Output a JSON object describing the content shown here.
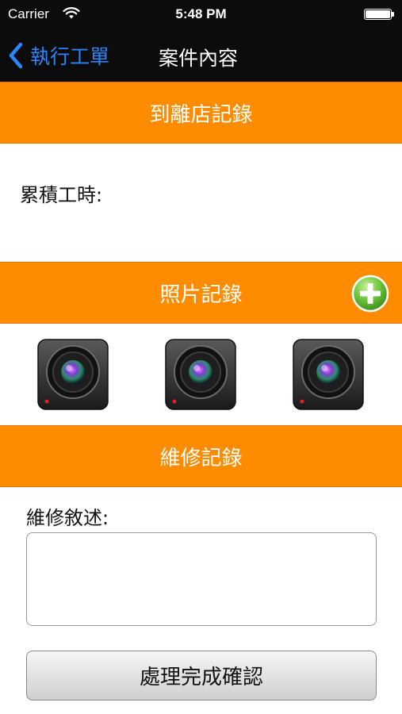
{
  "status_bar": {
    "carrier": "Carrier",
    "time": "5:48 PM",
    "wifi_icon": "wifi-icon",
    "battery_icon": "battery-icon"
  },
  "nav": {
    "back_label": "執行工單",
    "title": "案件內容",
    "back_color": "#2a86ff"
  },
  "sections": {
    "store_record": {
      "title": "到離店記錄",
      "hours_label": "累積工時:"
    },
    "photo_record": {
      "title": "照片記錄",
      "add_icon": "plus-circle-icon",
      "photos": [
        "camera-icon",
        "camera-icon",
        "camera-icon"
      ]
    },
    "repair_record": {
      "title": "維修記錄",
      "description_label": "維修敘述:",
      "description_value": ""
    }
  },
  "actions": {
    "confirm_label": "處理完成確認"
  },
  "colors": {
    "accent": "#ff8c00",
    "nav_background": "#0c0c0c",
    "add_button": "#6cc53a"
  }
}
